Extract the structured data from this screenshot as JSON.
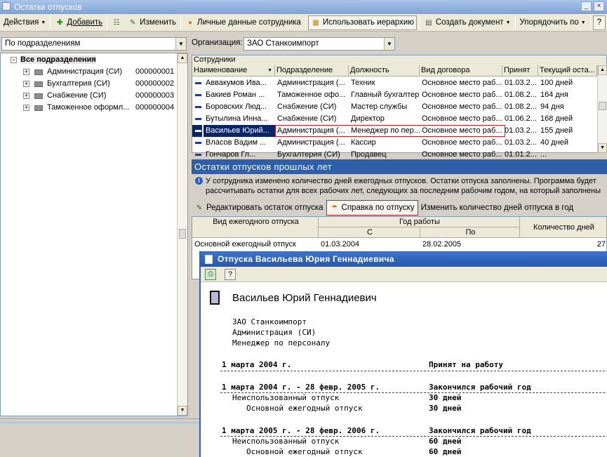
{
  "window": {
    "title": "Остатки отпусков"
  },
  "toolbar": {
    "actions": "Действия",
    "add": "Добавить",
    "edit": "Изменить",
    "personal": "Личные данные сотрудника",
    "hierarchy": "Использовать иерархию",
    "create_doc": "Создать документ",
    "sort": "Упорядочить по",
    "help": "?"
  },
  "left": {
    "group_mode": "По подразделениям",
    "tree": [
      {
        "label": "Все подразделения",
        "code": ""
      },
      {
        "label": "Администрация (СИ)",
        "code": "000000001"
      },
      {
        "label": "Бухгалтерия (СИ)",
        "code": "000000002"
      },
      {
        "label": "Снабжение (СИ)",
        "code": "000000003"
      },
      {
        "label": "Таможенное оформл...",
        "code": "000000004"
      }
    ]
  },
  "org": {
    "label": "Организация:",
    "value": "ЗАО Станкоимпорт"
  },
  "employees": {
    "caption": "Сотрудники",
    "columns": [
      "Наименование",
      "Подразделение",
      "Должность",
      "Вид договора",
      "Принят",
      "Текущий оста..."
    ],
    "rows": [
      [
        "Аввакумов Ива...",
        "Администрация (...",
        "Техник",
        "Основное место раб...",
        "01.03.2...",
        "100 дней"
      ],
      [
        "Бакиев Роман ...",
        "Таможенное офо...",
        "Главный бухгалтер",
        "Основное место раб...",
        "01.08.2...",
        "164 дня"
      ],
      [
        "Боровских Люд...",
        "Снабжение (СИ)",
        "Мастер службы",
        "Основное место раб...",
        "01.08.2...",
        "94 дня"
      ],
      [
        "Бутылина Инна...",
        "Снабжение (СИ)",
        "Директор",
        "Основное место раб...",
        "01.06.2...",
        "168 дней"
      ],
      [
        "Васильев Юрий...",
        "Администрация (...",
        "Менеджер по пер...",
        "Основное место раб...",
        "01.03.2...",
        "155 дней"
      ],
      [
        "Власов Вадим ...",
        "Администрация (...",
        "Кассир",
        "Основное место раб...",
        "01.03.2...",
        "40 дней"
      ],
      [
        "Гончаров Гл...",
        "Бухгалтерия (СИ)",
        "Продавец",
        "Основное место раб...",
        "01.01.2...",
        "..."
      ]
    ],
    "selected_index": 4
  },
  "section": {
    "title": "Остатки отпусков прошлых лет"
  },
  "info": {
    "line1": "У сотрудника изменено количество дней ежегодных отпусков. Остатки отпуска заполнены. Программа будет",
    "line2": "рассчитывать остатки для всех рабочих лет, следующих за последним рабочим годом, на который заполнены"
  },
  "actions": {
    "edit_balance": "Редактировать остаток отпуска",
    "report": "Справка по отпуску",
    "change_days": "Изменить количество дней отпуска в год"
  },
  "vacgrid": {
    "col_kind": "Вид ежегодного отпуска",
    "col_year": "Год работы",
    "col_from": "С",
    "col_to": "По",
    "col_days": "Количество дней",
    "rows": [
      {
        "kind": "Основной ежегодный отпуск",
        "from": "01.03.2004",
        "to": "28.02.2005",
        "days": "27"
      }
    ]
  },
  "popup": {
    "title": "Отпуска Васильева Юрия Геннадиевича",
    "name": "Васильев Юрий Геннадиевич",
    "org": "ЗАО Станкоимпорт",
    "dept": "Администрация (СИ)",
    "position": "Менеджер по персоналу",
    "hired_date": "1 марта 2004 г.",
    "hired_label": "Принят на работу",
    "periods": [
      {
        "range": "1 марта 2004 г. - 28 февр. 2005 г.",
        "status": "Закончился рабочий год",
        "unused_label": "Неиспользованный отпуск",
        "unused": "30 дней",
        "kind_label": "Основной ежегодный отпуск",
        "kind": "30 дней"
      },
      {
        "range": "1 марта 2005 г. - 28 февр. 2006 г.",
        "status": "Закончился рабочий год",
        "unused_label": "Неиспользованный отпуск",
        "unused": "60 дней",
        "kind_label": "Основной ежегодный отпуск",
        "kind": "60 дней"
      }
    ]
  }
}
